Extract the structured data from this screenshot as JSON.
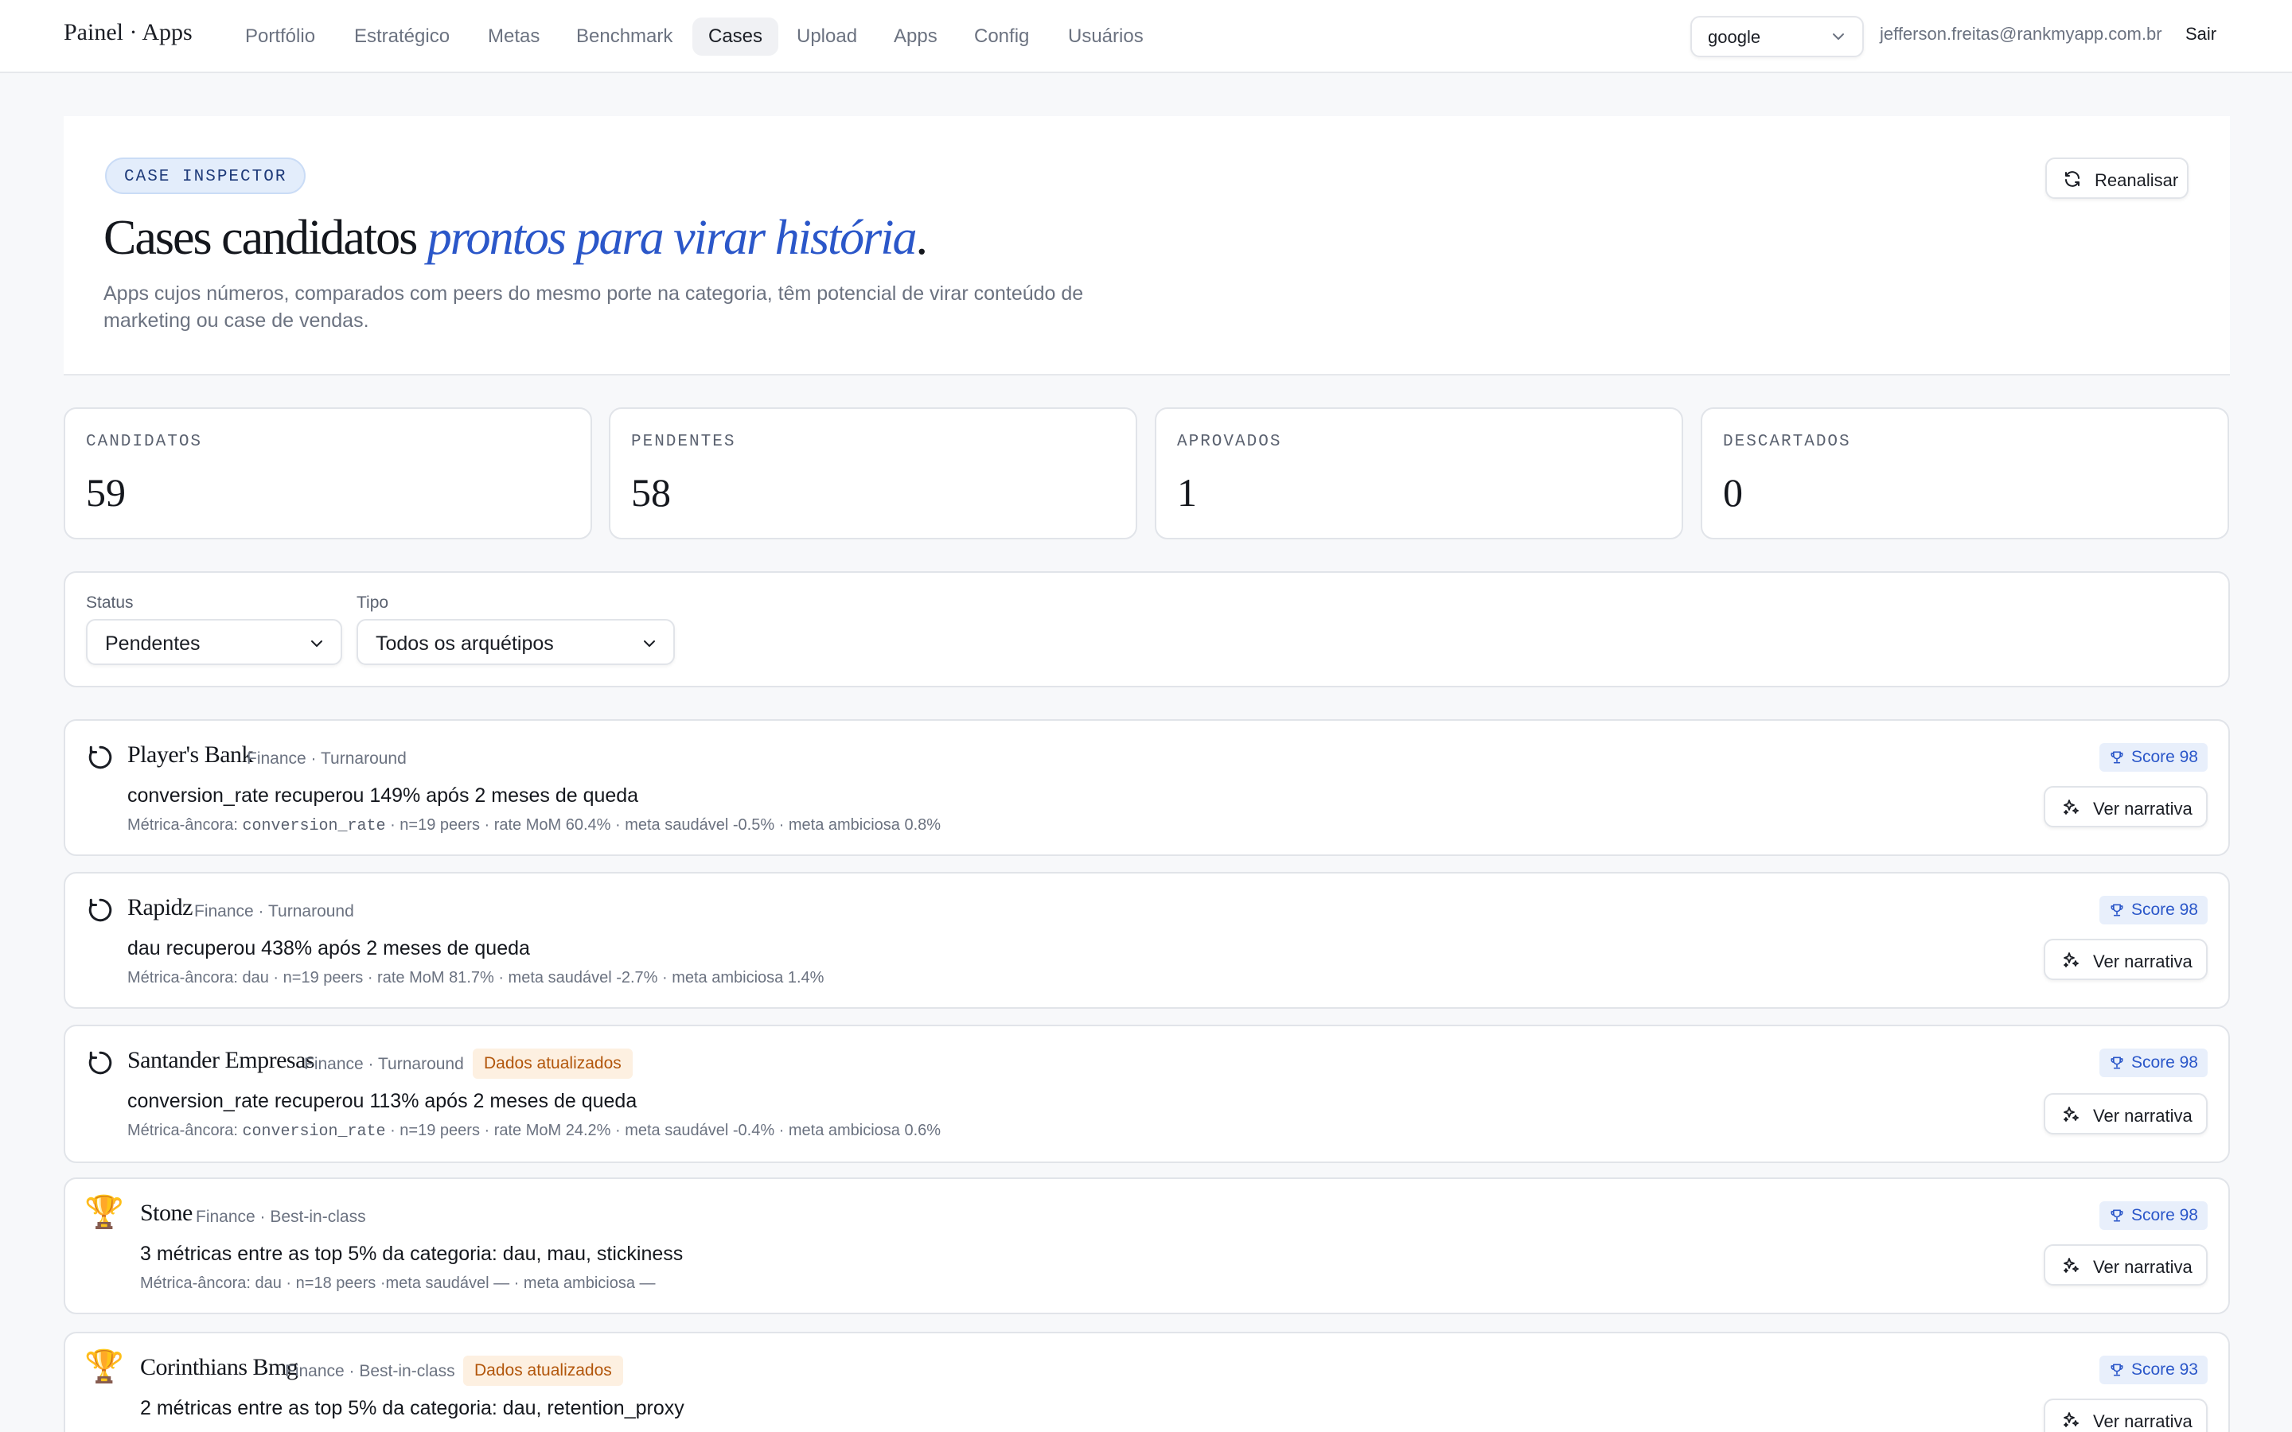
{
  "brand": "Painel · Apps",
  "nav": [
    "Portfólio",
    "Estratégico",
    "Metas",
    "Benchmark",
    "Cases",
    "Upload",
    "Apps",
    "Config",
    "Usuários"
  ],
  "nav_active": "Cases",
  "org_select": "google",
  "user_email": "jefferson.freitas@rankmyapp.com.br",
  "logout": "Sair",
  "hero": {
    "eyebrow": "CASE INSPECTOR",
    "title_plain": "Cases candidatos",
    "title_accent": "prontos para virar história",
    "title_end": ".",
    "description": "Apps cujos números, comparados com peers do mesmo porte na categoria, têm potencial de virar conteúdo de marketing ou case de vendas.",
    "reanalyze": "Reanalisar"
  },
  "stats": [
    {
      "label": "CANDIDATOS",
      "value": "59"
    },
    {
      "label": "PENDENTES",
      "value": "58"
    },
    {
      "label": "APROVADOS",
      "value": "1"
    },
    {
      "label": "DESCARTADOS",
      "value": "0"
    }
  ],
  "filters": {
    "status_label": "Status",
    "status_value": "Pendentes",
    "type_label": "Tipo",
    "type_value": "Todos os arquétipos"
  },
  "cases": [
    {
      "icon": "turnaround-icon",
      "name": "Player's Bank",
      "meta": "Finance · Turnaround",
      "updated": "",
      "headline": "conversion_rate recuperou 149% após 2 meses de queda",
      "detail_prefix": "Métrica-âncora: ",
      "detail_metric": "conversion_rate",
      "detail_rest": " · n=19 peers · rate MoM 60.4% · meta saudável -0.5% · meta ambiciosa 0.8%",
      "score": "Score 98",
      "action": "Ver narrativa"
    },
    {
      "icon": "turnaround-icon",
      "name": "Rapidz",
      "meta": "Finance · Turnaround",
      "updated": "",
      "headline": "dau recuperou 438% após 2 meses de queda",
      "detail_prefix": "Métrica-âncora: ",
      "detail_metric": "",
      "detail_rest": "dau · n=19 peers · rate MoM 81.7% · meta saudável -2.7% · meta ambiciosa 1.4%",
      "score": "Score 98",
      "action": "Ver narrativa"
    },
    {
      "icon": "turnaround-icon",
      "name": "Santander Empresas",
      "meta": "Finance · Turnaround",
      "updated": "Dados atualizados",
      "headline": "conversion_rate recuperou 113% após 2 meses de queda",
      "detail_prefix": "Métrica-âncora: ",
      "detail_metric": "conversion_rate",
      "detail_rest": " · n=19 peers · rate MoM 24.2% · meta saudável -0.4% · meta ambiciosa 0.6%",
      "score": "Score 98",
      "action": "Ver narrativa"
    },
    {
      "icon": "trophy-icon",
      "name": "Stone",
      "meta": "Finance · Best-in-class",
      "updated": "",
      "headline": "3 métricas entre as top 5% da categoria: dau, mau, stickiness",
      "detail_prefix": "Métrica-âncora: ",
      "detail_metric": "",
      "detail_rest": "dau · n=18 peers ·meta saudável — · meta ambiciosa —",
      "score": "Score 98",
      "action": "Ver narrativa"
    },
    {
      "icon": "trophy-icon",
      "name": "Corinthians Bmg",
      "meta": "Finance · Best-in-class",
      "updated": "Dados atualizados",
      "headline": "2 métricas entre as top 5% da categoria: dau, retention_proxy",
      "detail_prefix": "",
      "detail_metric": "",
      "detail_rest": "",
      "score": "Score 93",
      "action": "Ver narrativa"
    }
  ]
}
